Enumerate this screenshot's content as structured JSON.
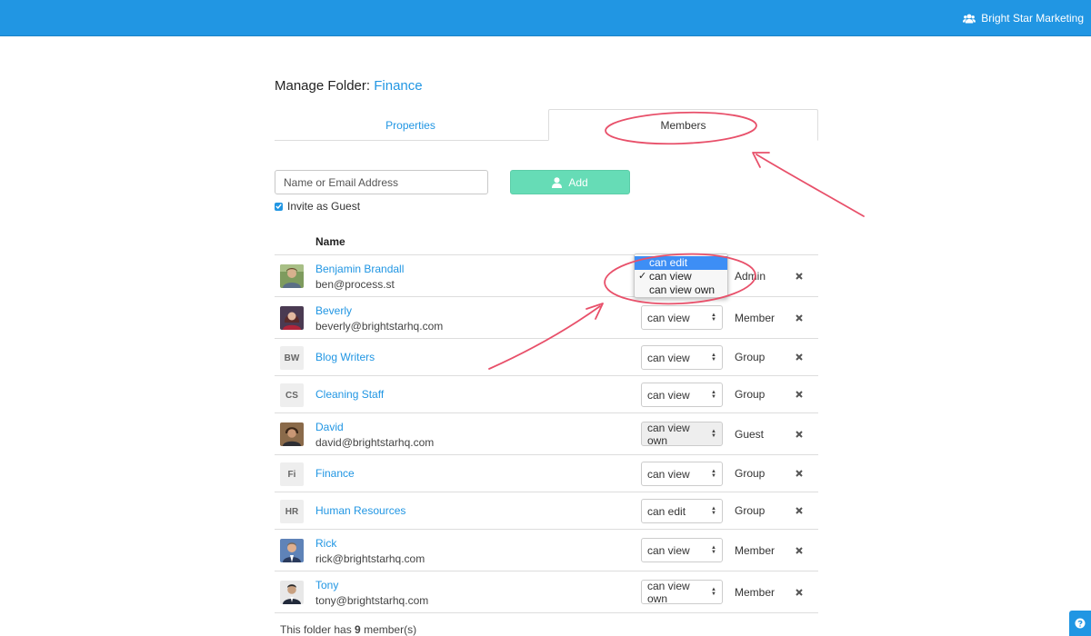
{
  "header": {
    "org_name": "Bright Star Marketing",
    "org_icon": "users-icon",
    "color": "#2196e3"
  },
  "page": {
    "title_prefix": "Manage Folder:",
    "folder_name": "Finance"
  },
  "tabs": [
    {
      "label": "Properties",
      "active": false
    },
    {
      "label": "Members",
      "active": true
    }
  ],
  "invite": {
    "placeholder": "Name or Email Address",
    "value": "",
    "add_label": "Add",
    "add_icon": "user-icon",
    "guest_label": "Invite as Guest",
    "guest_checked": true
  },
  "table": {
    "name_header": "Name",
    "rows": [
      {
        "name": "Benjamin Brandall",
        "email": "ben@process.st",
        "avatar": "photo",
        "permission": "can view",
        "role": "Admin"
      },
      {
        "name": "Beverly",
        "email": "beverly@brightstarhq.com",
        "avatar": "photo",
        "permission": "can view",
        "role": "Member"
      },
      {
        "name": "Blog Writers",
        "initials": "BW",
        "permission": "can view",
        "role": "Group"
      },
      {
        "name": "Cleaning Staff",
        "initials": "CS",
        "permission": "can view",
        "role": "Group"
      },
      {
        "name": "David",
        "email": "david@brightstarhq.com",
        "avatar": "photo",
        "permission": "can view own",
        "role": "Guest"
      },
      {
        "name": "Finance",
        "initials": "Fi",
        "permission": "can view",
        "role": "Group"
      },
      {
        "name": "Human Resources",
        "initials": "HR",
        "permission": "can edit",
        "role": "Group"
      },
      {
        "name": "Rick",
        "email": "rick@brightstarhq.com",
        "avatar": "photo",
        "permission": "can view",
        "role": "Member"
      },
      {
        "name": "Tony",
        "email": "tony@brightstarhq.com",
        "avatar": "photo",
        "permission": "can view own",
        "role": "Member"
      }
    ]
  },
  "dropdown": {
    "options": [
      "can edit",
      "can view",
      "can view own"
    ],
    "highlighted": "can edit",
    "selected": "can view",
    "check_mark": "✓"
  },
  "footer": {
    "prefix": "This folder has",
    "count": "9",
    "suffix": "member(s)"
  },
  "help_icon": "question-icon"
}
